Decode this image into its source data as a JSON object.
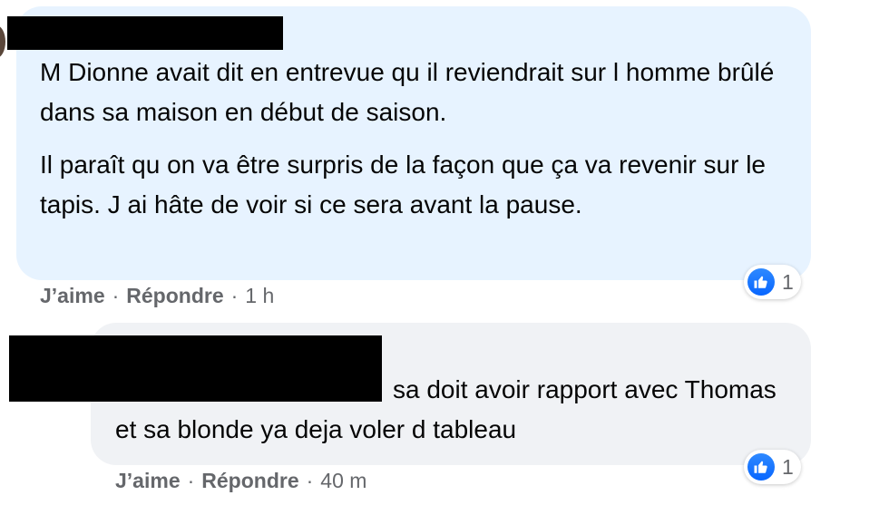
{
  "comments": [
    {
      "paragraphs": [
        "M Dionne avait dit en entrevue qu il reviendrait sur l homme brûlé dans sa maison en début de saison.",
        "Il paraît qu on va être surpris de la façon que ça va revenir sur le tapis. J ai hâte de voir si ce sera avant la pause."
      ],
      "like_label": "J’aime",
      "reply_label": "Répondre",
      "time": "1 h",
      "reaction_icon": "like-icon",
      "reaction_count": "1"
    },
    {
      "text": "sa doit avoir rapport avec Thomas et sa blonde ya deja voler d tableau",
      "like_label": "J’aime",
      "reply_label": "Répondre",
      "time": "40 m",
      "reaction_icon": "like-icon",
      "reaction_count": "1"
    }
  ],
  "separator": "·",
  "colors": {
    "bubble_highlight": "#e7f3ff",
    "bubble_default": "#f0f2f5",
    "like_blue": "#0866ff",
    "meta_gray": "#65676b"
  }
}
